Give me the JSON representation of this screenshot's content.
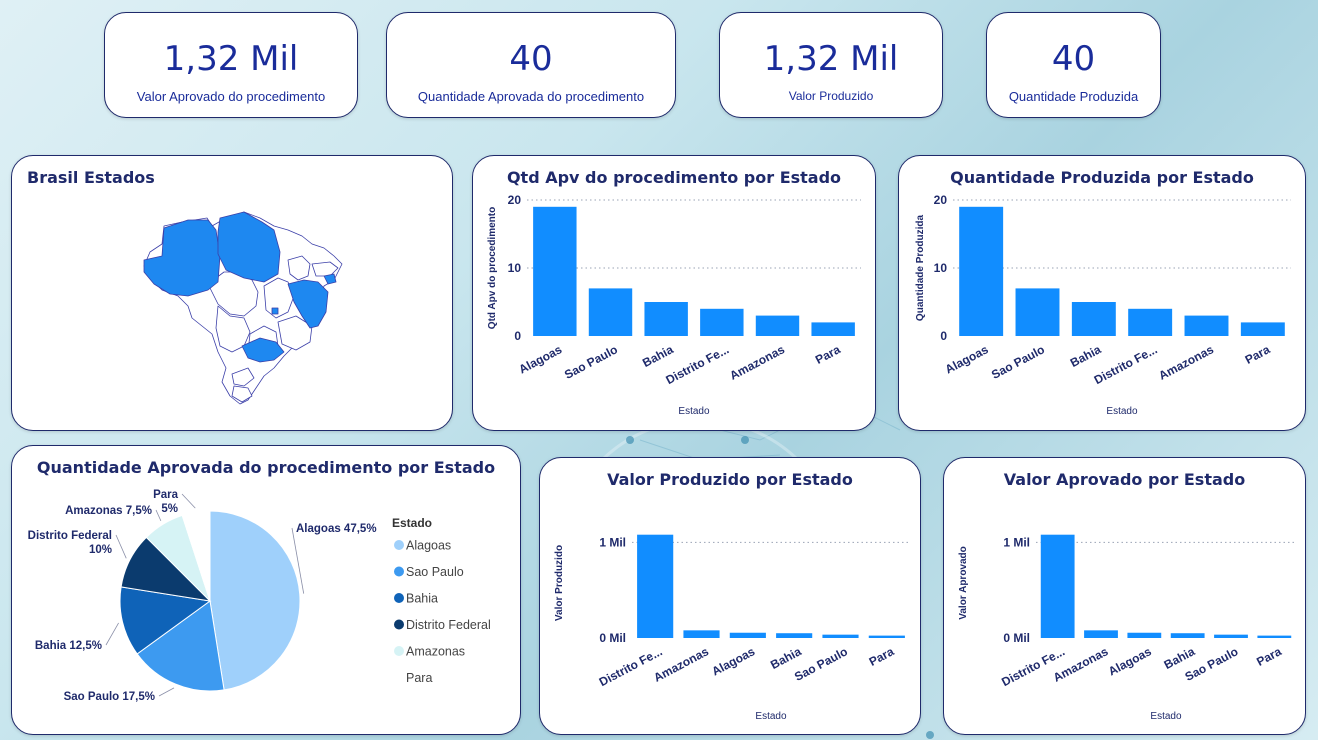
{
  "colors": {
    "bar": "#118dff",
    "title": "#1f2a6b",
    "kpi": "#1a2c9a",
    "map_fill": "#1e88f0",
    "map_stroke": "#3b3fa8"
  },
  "kpis": [
    {
      "value": "1,32 Mil",
      "label": "Valor Aprovado do procedimento"
    },
    {
      "value": "40",
      "label": "Quantidade Aprovada do procedimento"
    },
    {
      "value": "1,32 Mil",
      "label": "Valor Produzido"
    },
    {
      "value": "40",
      "label": "Quantidade Produzida"
    }
  ],
  "map": {
    "title": "Brasil Estados",
    "highlighted": [
      "Amazonas",
      "Para",
      "Alagoas",
      "Bahia",
      "Sao Paulo",
      "Distrito Federal"
    ]
  },
  "charts": {
    "qtd_apv": {
      "type": "bar",
      "title": "Qtd Apv do procedimento por Estado",
      "categories": [
        "Alagoas",
        "Sao Paulo",
        "Bahia",
        "Distrito Fe...",
        "Amazonas",
        "Para"
      ],
      "values": [
        19,
        7,
        5,
        4,
        3,
        2
      ],
      "ylabel": "Qtd Apv do procedimento",
      "xlabel": "Estado",
      "yticks": [
        {
          "v": 0,
          "t": "0"
        },
        {
          "v": 10,
          "t": "10"
        },
        {
          "v": 20,
          "t": "20"
        }
      ],
      "ylim": [
        0,
        20
      ]
    },
    "qtd_prod": {
      "type": "bar",
      "title": "Quantidade Produzida por Estado",
      "categories": [
        "Alagoas",
        "Sao Paulo",
        "Bahia",
        "Distrito Fe...",
        "Amazonas",
        "Para"
      ],
      "values": [
        19,
        7,
        5,
        4,
        3,
        2
      ],
      "ylabel": "Quantidade Produzida",
      "xlabel": "Estado",
      "yticks": [
        {
          "v": 0,
          "t": "0"
        },
        {
          "v": 10,
          "t": "10"
        },
        {
          "v": 20,
          "t": "20"
        }
      ],
      "ylim": [
        0,
        20
      ]
    },
    "valor_prod": {
      "type": "bar",
      "title": "Valor Produzido por Estado",
      "categories": [
        "Distrito Fe...",
        "Amazonas",
        "Alagoas",
        "Bahia",
        "Sao Paulo",
        "Para"
      ],
      "values": [
        1080,
        80,
        55,
        50,
        35,
        25
      ],
      "ylabel": "Valor Produzido",
      "xlabel": "Estado",
      "yticks": [
        {
          "v": 0,
          "t": "0 Mil"
        },
        {
          "v": 1000,
          "t": "1 Mil"
        }
      ],
      "ylim": [
        0,
        1150
      ]
    },
    "valor_apv": {
      "type": "bar",
      "title": "Valor Aprovado por Estado",
      "categories": [
        "Distrito Fe...",
        "Amazonas",
        "Alagoas",
        "Bahia",
        "Sao Paulo",
        "Para"
      ],
      "values": [
        1080,
        80,
        55,
        50,
        35,
        25
      ],
      "ylabel": "Valor Aprovado",
      "xlabel": "Estado",
      "yticks": [
        {
          "v": 0,
          "t": "0 Mil"
        },
        {
          "v": 1000,
          "t": "1 Mil"
        }
      ],
      "ylim": [
        0,
        1150
      ]
    },
    "pie": {
      "type": "pie",
      "title": "Quantidade Aprovada do procedimento por Estado",
      "legend_title": "Estado",
      "slices": [
        {
          "name": "Alagoas",
          "value": 47.5,
          "label": "Alagoas 47,5%",
          "color": "#9fd0fb"
        },
        {
          "name": "Sao Paulo",
          "value": 17.5,
          "label": "Sao Paulo 17,5%",
          "color": "#3d9af0"
        },
        {
          "name": "Bahia",
          "value": 12.5,
          "label": "Bahia 12,5%",
          "color": "#0f63b8"
        },
        {
          "name": "Distrito Federal",
          "value": 10,
          "label": "Distrito Federal\n10%",
          "color": "#0b3b6e"
        },
        {
          "name": "Amazonas",
          "value": 7.5,
          "label": "Amazonas 7,5%",
          "color": "#d6f3f5"
        },
        {
          "name": "Para",
          "value": 5,
          "label": "Para\n5%",
          "color": "#ffffff"
        }
      ]
    }
  }
}
